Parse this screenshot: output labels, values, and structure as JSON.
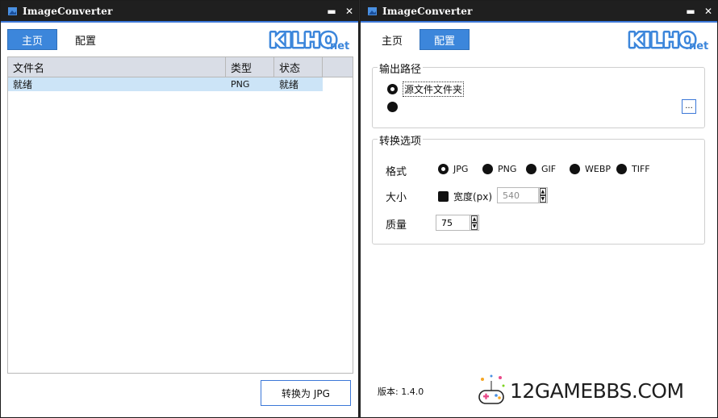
{
  "app": {
    "title": "ImageConverter"
  },
  "titlebar": {
    "minimize": "▬",
    "close": "✕"
  },
  "nav": {
    "home": "主页",
    "config": "配置"
  },
  "logo": {
    "main": "KILHO",
    "suffix": ".net"
  },
  "filelist": {
    "columns": [
      "文件名",
      "类型",
      "状态"
    ],
    "rows": [
      {
        "name": "就绪",
        "type": "PNG",
        "status": "就绪"
      }
    ]
  },
  "convert_button": "转换为 JPG",
  "output_group": {
    "legend": "输出路径",
    "option_source": "源文件文件夹",
    "browse": "..."
  },
  "convert_group": {
    "legend": "转换选项",
    "format_label": "格式",
    "formats": [
      "JPG",
      "PNG",
      "GIF",
      "WEBP",
      "TIFF"
    ],
    "selected_format": "JPG",
    "size_label": "大小",
    "width_label": "宽度(px)",
    "width_value": "540",
    "quality_label": "质量",
    "quality_value": "75"
  },
  "version": "版本: 1.4.0",
  "watermark": "12GAMEBBS.COM",
  "colors": {
    "accent": "#3c86db",
    "titlebar": "#1f1f1f",
    "selection": "#cce4f7",
    "header": "#d9dde6"
  }
}
